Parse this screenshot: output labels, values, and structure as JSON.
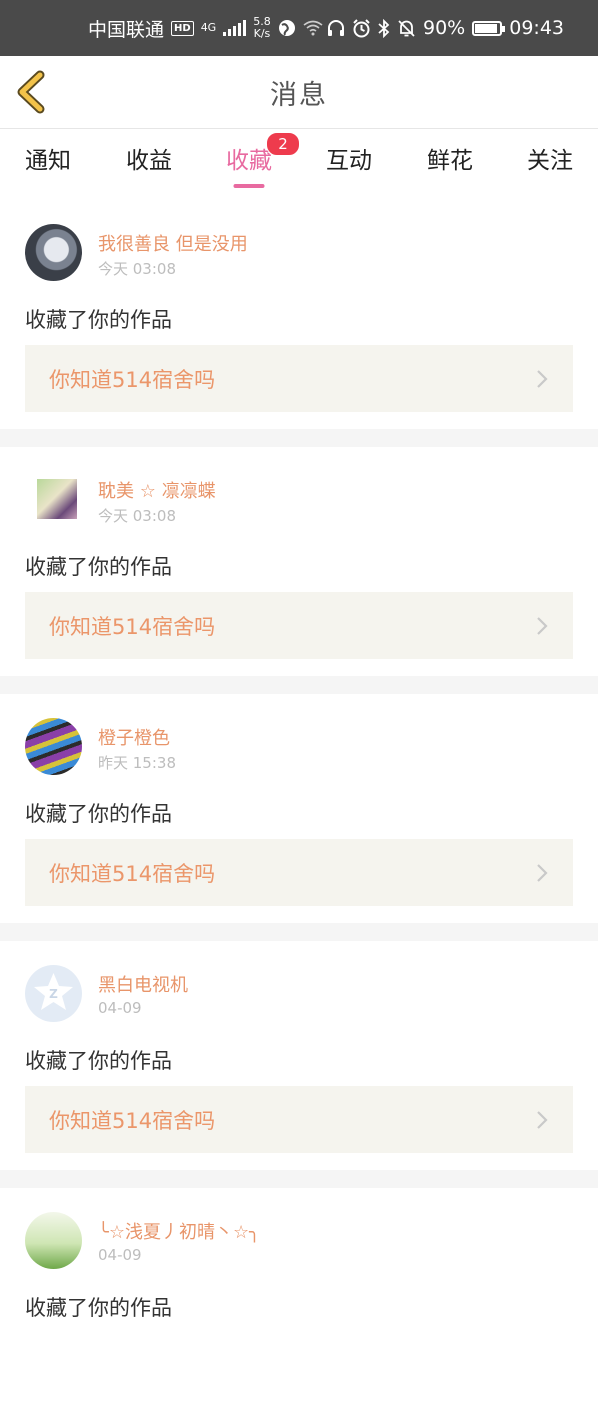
{
  "status_bar": {
    "carrier": "中国联通",
    "hd": "HD",
    "net_type": "4G",
    "speed_value": "5.8",
    "speed_unit": "K/s",
    "battery": "90%",
    "battery_level": 0.9,
    "time": "09:43",
    "icons": [
      "signal-icon",
      "globe-icon",
      "wifi-icon",
      "headphones-icon",
      "alarm-icon",
      "bluetooth-icon",
      "mute-icon",
      "battery-icon"
    ]
  },
  "header": {
    "title": "消息",
    "back_icon": "chevron-left-icon"
  },
  "tabs": [
    {
      "label": "通知",
      "active": false
    },
    {
      "label": "收益",
      "active": false
    },
    {
      "label": "收藏",
      "active": true,
      "badge": "2"
    },
    {
      "label": "互动",
      "active": false
    },
    {
      "label": "鲜花",
      "active": false
    },
    {
      "label": "关注",
      "active": false
    }
  ],
  "colors": {
    "accent_pink": "#e86aa0",
    "username_orange": "#e8956a",
    "badge_red": "#ee3b4d",
    "work_bg": "#f5f4ee"
  },
  "messages": [
    {
      "username": "我很善良 但是没用",
      "time": "今天 03:08",
      "action": "收藏了你的作品",
      "work_title": "你知道514宿舍吗"
    },
    {
      "username": "耽美 ☆ 凛凛蝶",
      "time": "今天 03:08",
      "action": "收藏了你的作品",
      "work_title": "你知道514宿舍吗"
    },
    {
      "username": "橙子橙色",
      "time": "昨天 15:38",
      "action": "收藏了你的作品",
      "work_title": "你知道514宿舍吗"
    },
    {
      "username": "黑白电视机",
      "time": "04-09",
      "action": "收藏了你的作品",
      "work_title": "你知道514宿舍吗"
    },
    {
      "username": "╰☆浅夏丿初晴丶☆╮",
      "time": "04-09",
      "action": "收藏了你的作品",
      "work_title": ""
    }
  ]
}
